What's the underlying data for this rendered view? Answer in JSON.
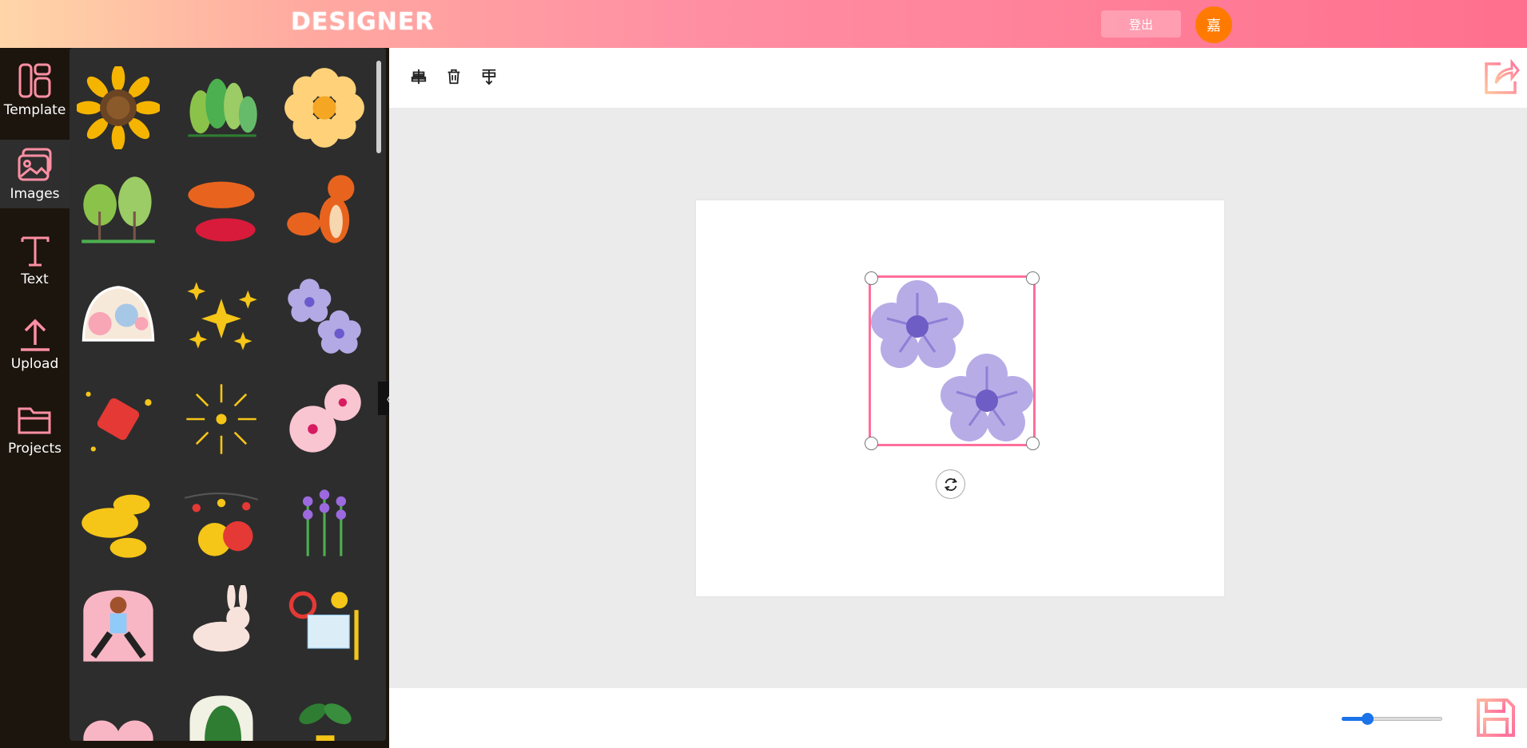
{
  "header": {
    "logo": "DESIGNER",
    "logout_label": "登出",
    "avatar_initial": "嘉"
  },
  "sidebar": {
    "items": [
      {
        "label": "Template",
        "icon": "template-icon"
      },
      {
        "label": "Images",
        "icon": "images-icon",
        "active": true
      },
      {
        "label": "Text",
        "icon": "text-icon"
      },
      {
        "label": "Upload",
        "icon": "upload-icon"
      },
      {
        "label": "Projects",
        "icon": "folder-icon"
      }
    ]
  },
  "images_panel": {
    "items": [
      "sunflower",
      "forest",
      "yellow-flower",
      "trees",
      "clouds",
      "fox",
      "floral-scene",
      "sparkles",
      "purple-flowers",
      "firecrackers",
      "fireworks",
      "cherry-blossoms",
      "golden-clouds",
      "lanterns",
      "lavender",
      "yoga-person",
      "bunny",
      "designer-tools",
      "cute-creatures",
      "cactus",
      "potted-plant"
    ]
  },
  "toolbar": {
    "tools": [
      "align-center-icon",
      "trash-icon",
      "align-vertical-icon"
    ],
    "share_icon": "share-icon"
  },
  "canvas": {
    "selected_element": "purple-flowers"
  },
  "footer": {
    "zoom_value": 0.25,
    "save_icon": "save-icon"
  },
  "colors": {
    "accent": "#ff6f9c",
    "slider": "#1a73e8",
    "avatar": "#ff7a00"
  }
}
